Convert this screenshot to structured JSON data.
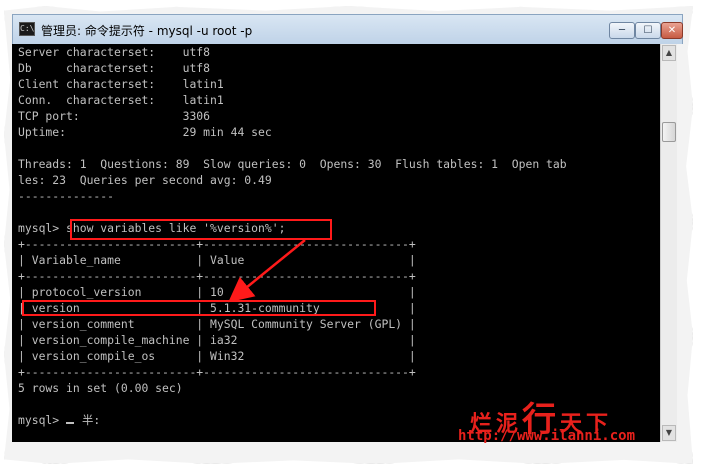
{
  "window": {
    "title": "管理员: 命令提示符 - mysql  -u root -p",
    "app_icon_text": "C:\\",
    "min_label": "─",
    "max_label": "☐",
    "close_label": "✕"
  },
  "console": {
    "lines": [
      "Server characterset:    utf8",
      "Db     characterset:    utf8",
      "Client characterset:    latin1",
      "Conn.  characterset:    latin1",
      "TCP port:               3306",
      "Uptime:                 29 min 44 sec",
      "",
      "Threads: 1  Questions: 89  Slow queries: 0  Opens: 30  Flush tables: 1  Open tab",
      "les: 23  Queries per second avg: 0.49",
      "--------------",
      "",
      "mysql> show variables like '%version%';",
      "+-------------------------+------------------------------+",
      "| Variable_name           | Value                        |",
      "+-------------------------+------------------------------+",
      "| protocol_version        | 10                           |",
      "| version                 | 5.1.31-community             |",
      "| version_comment         | MySQL Community Server (GPL) |",
      "| version_compile_machine | ia32                         |",
      "| version_compile_os      | Win32                        |",
      "+-------------------------+------------------------------+",
      "5 rows in set (0.00 sec)",
      "",
      "mysql> "
    ],
    "ime_hint": "半:"
  },
  "watermark": {
    "cn_a": "烂泥",
    "cn_b": "行",
    "cn_c": "天下",
    "url": "http://www.ilanni.com"
  },
  "colors": {
    "console_bg": "#000000",
    "console_fg": "#c0c0c0",
    "highlight": "#ff1a1a",
    "watermark": "#e8211c"
  }
}
